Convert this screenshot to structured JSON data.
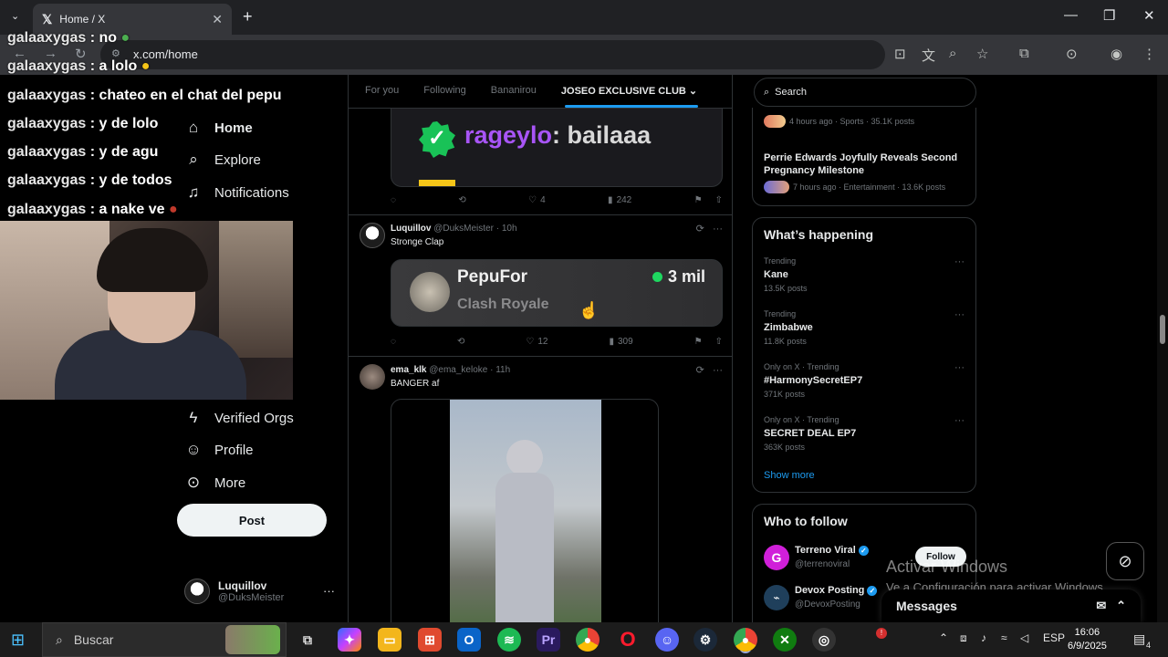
{
  "browser": {
    "tab_title": "Home / X",
    "url": "x.com/home",
    "new_tab": "+",
    "window_controls": [
      "—",
      "❐",
      "✕"
    ]
  },
  "stream_overlay": {
    "chat": [
      {
        "user": "galaaxygas",
        "text": "no"
      },
      {
        "user": "galaaxygas",
        "text": "a lolo"
      },
      {
        "user": "galaaxygas",
        "text": "chateo en el chat del pepu"
      },
      {
        "user": "galaaxygas",
        "text": "y de lolo"
      },
      {
        "user": "galaaxygas",
        "text": "y de agu"
      },
      {
        "user": "galaaxygas",
        "text": "y de todos"
      },
      {
        "user": "galaaxygas",
        "text": "a nake ve"
      }
    ]
  },
  "nav": {
    "items": [
      {
        "label": "Home",
        "icon": "home-icon"
      },
      {
        "label": "Explore",
        "icon": "search-icon"
      },
      {
        "label": "Notifications",
        "icon": "bell-icon"
      },
      {
        "label": "Verified Orgs",
        "icon": "lightning-icon"
      },
      {
        "label": "Profile",
        "icon": "person-icon"
      },
      {
        "label": "More",
        "icon": "more-circle-icon"
      }
    ],
    "post_button": "Post",
    "account": {
      "name": "Luquillov",
      "handle": "@DuksMeister",
      "more": "···"
    }
  },
  "feed_tabs": [
    "For you",
    "Following",
    "Bananirou",
    "JOSEO EXCLUSIVE CLUB"
  ],
  "tweets": [
    {
      "media_text": {
        "user": "rageylo",
        "message": "bailaaa"
      },
      "stats": {
        "likes": "4",
        "views": "242"
      }
    },
    {
      "name": "Luquillov",
      "handle": "@DuksMeister",
      "time": "10h",
      "text": "Stronge Clap",
      "media": {
        "title": "PepuFor",
        "subtitle": "Clash Royale",
        "viewers": "3 mil"
      },
      "stats": {
        "likes": "12",
        "views": "309"
      }
    },
    {
      "name": "ema_klk",
      "handle": "@ema_keloke",
      "time": "11h",
      "text": "BANGER af"
    }
  ],
  "right": {
    "search_placeholder": "Search",
    "top_news": {
      "meta1": "4 hours ago · Sports · 35.1K posts",
      "headline": "Perrie Edwards Joyfully Reveals Second Pregnancy Milestone",
      "meta2": "7 hours ago · Entertainment · 13.6K posts"
    },
    "whats_happening": {
      "title": "What’s happening",
      "trends": [
        {
          "meta": "Trending",
          "name": "Kane",
          "posts": "13.5K posts"
        },
        {
          "meta": "Trending",
          "name": "Zimbabwe",
          "posts": "11.8K posts"
        },
        {
          "meta": "Only on X · Trending",
          "name": "#HarmonySecretEP7",
          "posts": "371K posts"
        },
        {
          "meta": "Only on X · Trending",
          "name": "SECRET DEAL EP7",
          "posts": "363K posts"
        }
      ],
      "show_more": "Show more"
    },
    "who_to_follow": {
      "title": "Who to follow",
      "accounts": [
        {
          "name": "Terreno Viral",
          "handle": "@terrenoviral"
        },
        {
          "name": "Devox Posting",
          "handle": "@DevoxPosting"
        }
      ],
      "follow_label": "Follow"
    },
    "messages_label": "Messages"
  },
  "watermark": {
    "line1": "Activar Windows",
    "line2": "Ve a Configuración para activar Windows."
  },
  "taskbar": {
    "search": "Buscar",
    "lang": "ESP",
    "time": "16:06",
    "date": "6/9/2025",
    "notif_count": "4"
  }
}
